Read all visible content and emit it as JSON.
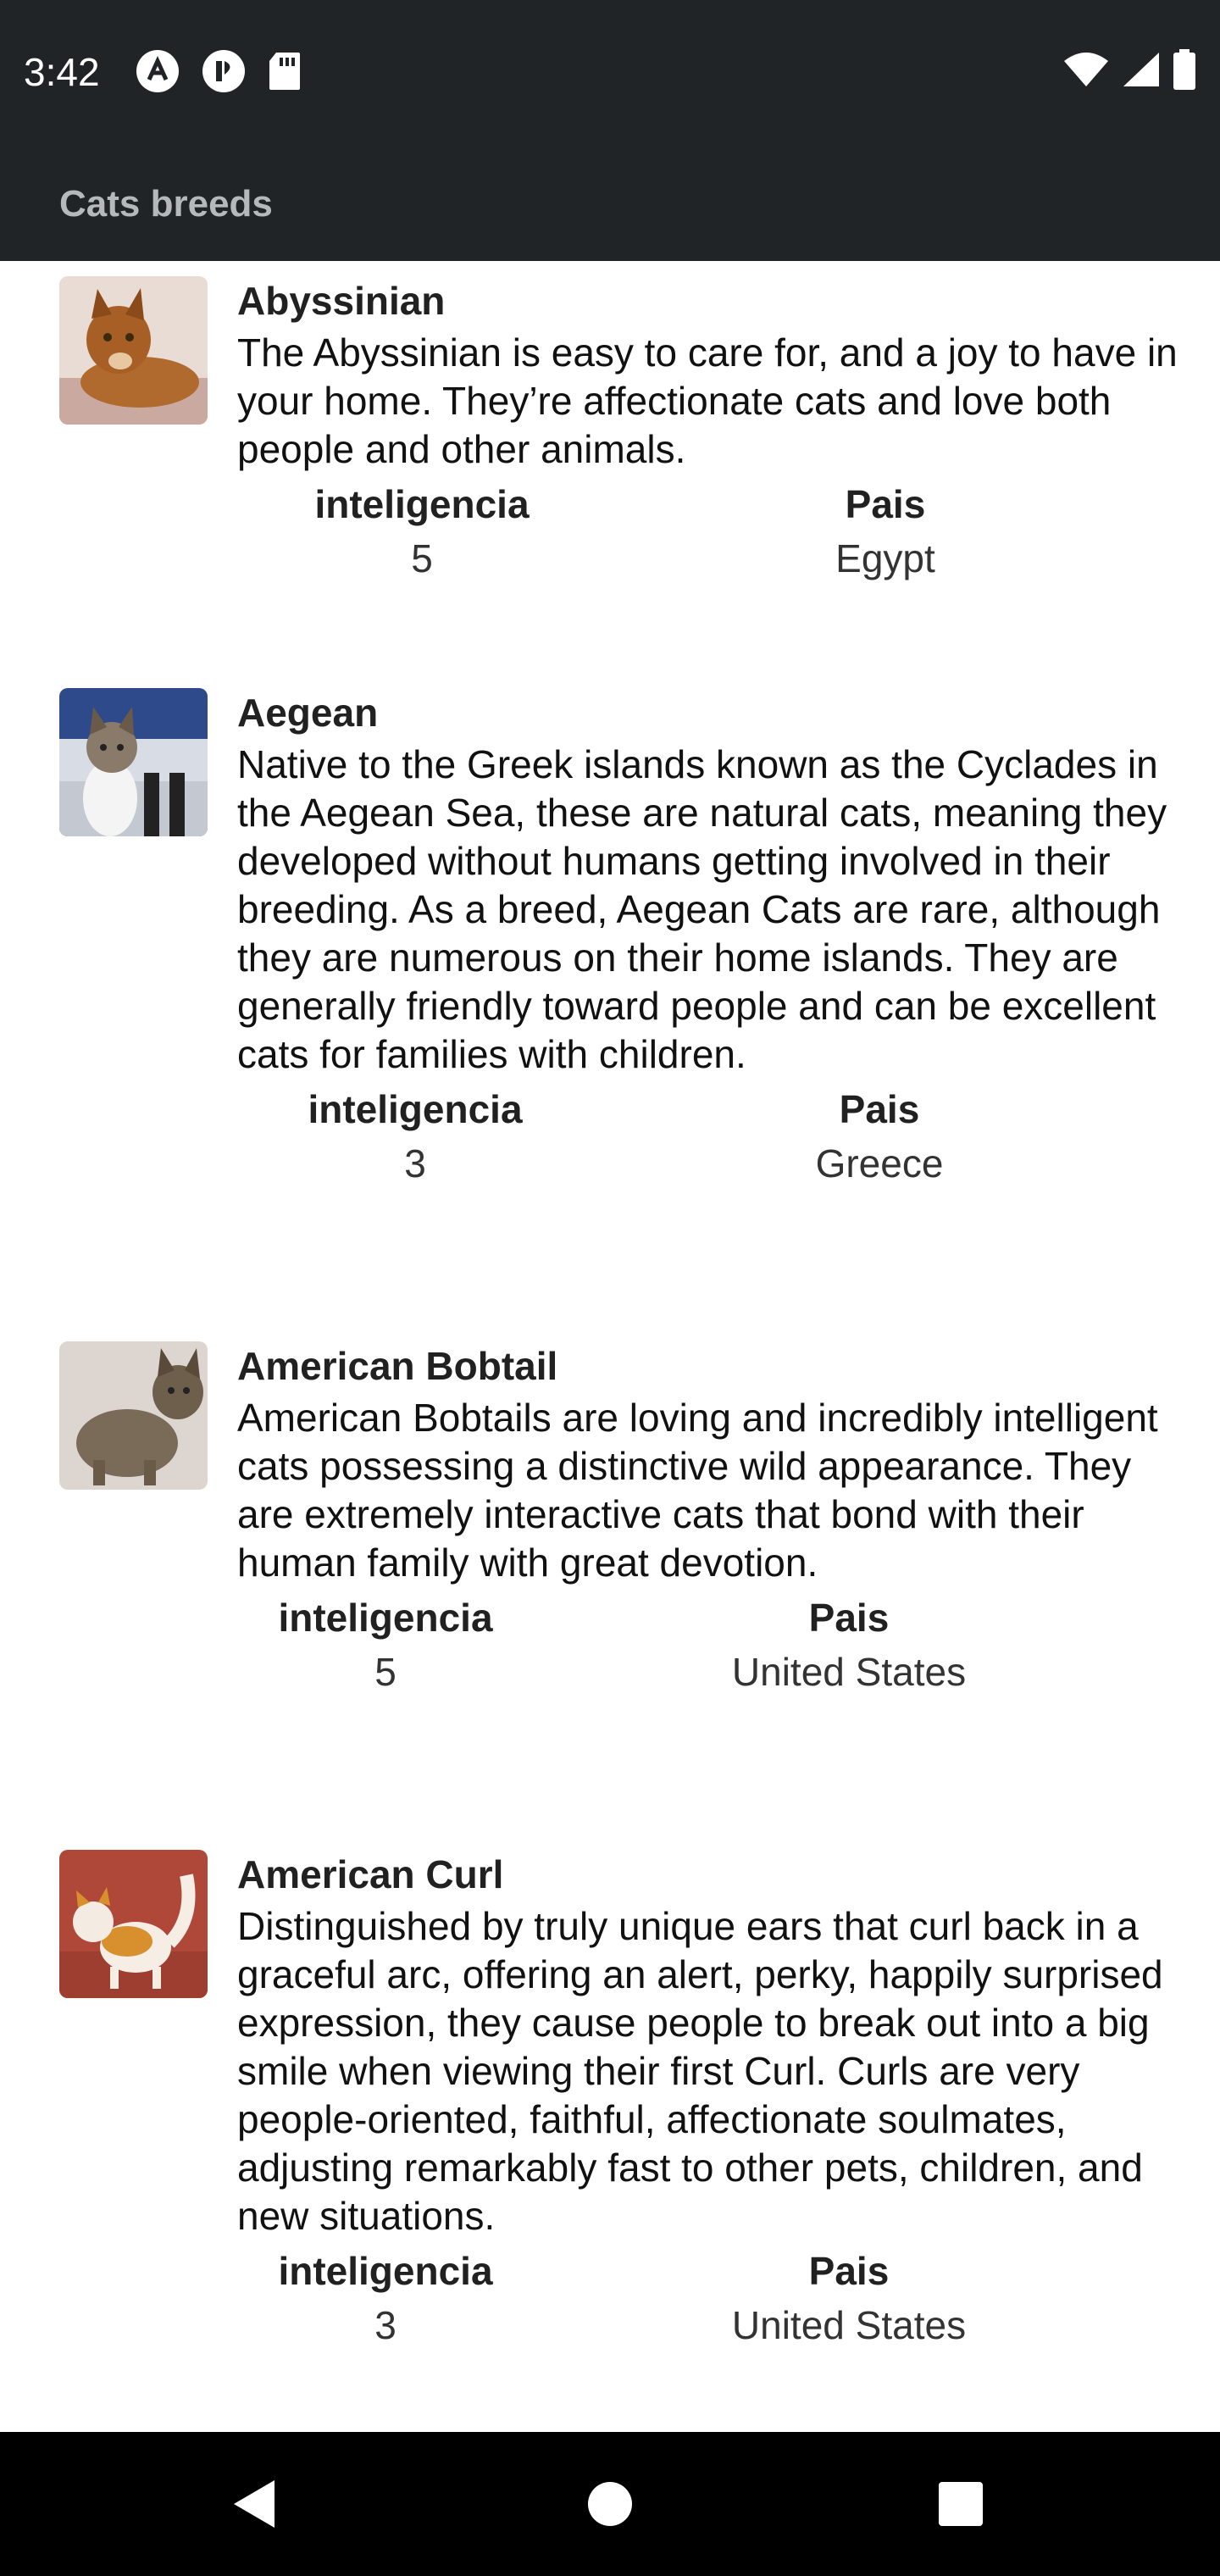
{
  "status_bar": {
    "time": "3:42",
    "left_icons": [
      "android-app-icon",
      "play-icon",
      "sd-card-icon"
    ],
    "right_icons": [
      "wifi-icon",
      "signal-icon",
      "battery-icon"
    ]
  },
  "app_bar": {
    "title": "Cats breeds"
  },
  "breeds": [
    {
      "name": "Abyssinian",
      "description": "The Abyssinian is easy to care for, and a joy to have in your home. They’re affectionate cats and love both people and other animals.",
      "intelligence_label": "inteligencia",
      "intelligence": "5",
      "country_label": "Pais",
      "country": "Egypt"
    },
    {
      "name": "Aegean",
      "description": "Native to the Greek islands known as the Cyclades in the Aegean Sea, these are natural cats, meaning they developed without humans getting involved in their breeding. As a breed, Aegean Cats are rare, although they are numerous on their home islands. They are generally friendly toward people and can be excellent cats for families with children.",
      "intelligence_label": "inteligencia",
      "intelligence": "3",
      "country_label": "Pais",
      "country": "Greece"
    },
    {
      "name": "American Bobtail",
      "description": "American Bobtails are loving and incredibly intelligent cats possessing a distinctive wild appearance. They are extremely interactive cats that bond with their human family with great devotion.",
      "intelligence_label": "inteligencia",
      "intelligence": "5",
      "country_label": "Pais",
      "country": "United States"
    },
    {
      "name": "American Curl",
      "description": "Distinguished by truly unique ears that curl back in a graceful arc, offering an alert, perky, happily surprised expression, they cause people to break out into a big smile when viewing their first Curl. Curls are very people-oriented, faithful, affectionate soulmates, adjusting remarkably fast to other pets, children, and new situations.",
      "intelligence_label": "inteligencia",
      "intelligence": "3",
      "country_label": "Pais",
      "country": "United States"
    }
  ],
  "nav_bar": {
    "icons": [
      "back-icon",
      "home-icon",
      "recents-icon"
    ]
  }
}
